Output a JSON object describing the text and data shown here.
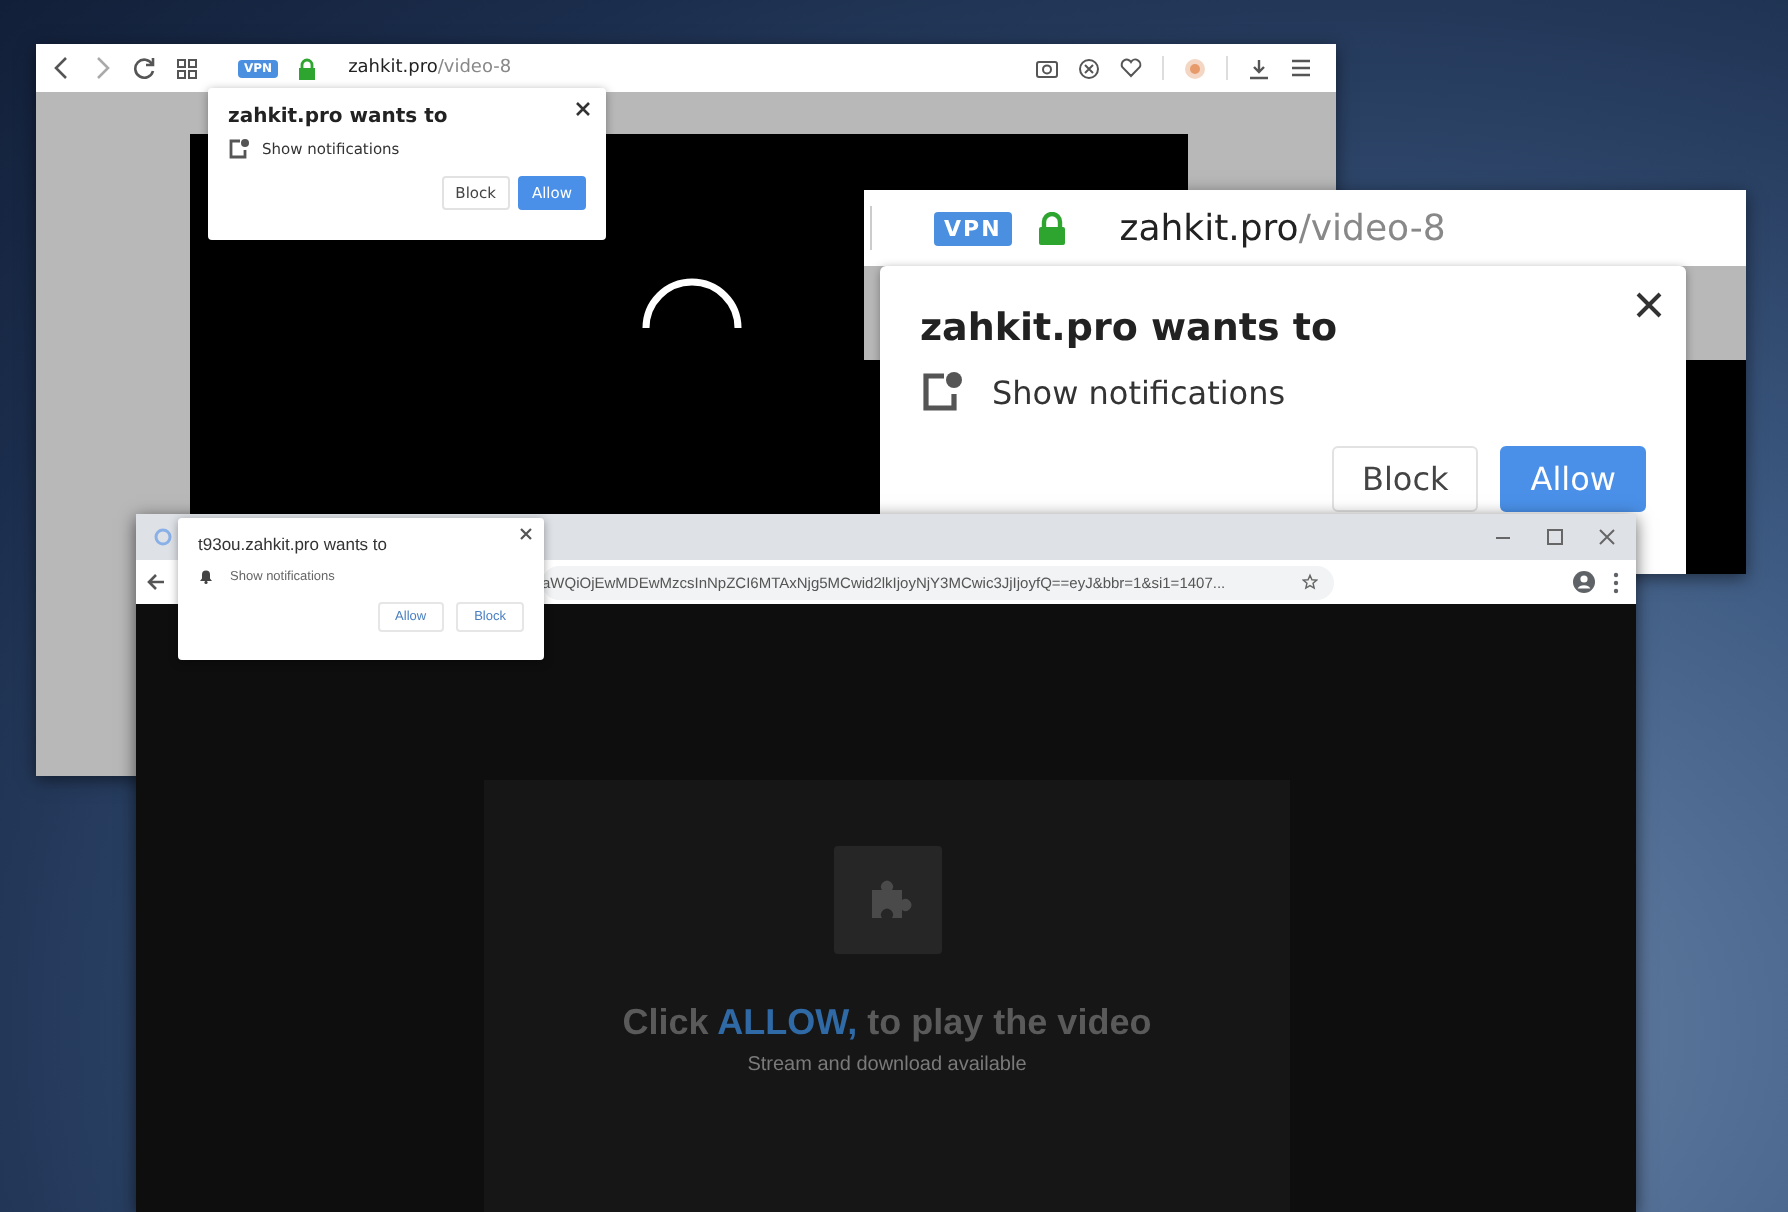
{
  "back_window": {
    "toolbar": {
      "vpn_badge": "VPN",
      "url_host": "zahkit.pro",
      "url_path": "/video-8"
    },
    "popup": {
      "title": "zahkit.pro wants to",
      "permission": "Show notifications",
      "buttons": [
        {
          "label": "Block",
          "kind": "secondary"
        },
        {
          "label": "Allow",
          "kind": "primary"
        }
      ]
    }
  },
  "zoomed_inset": {
    "toolbar": {
      "vpn_badge": "VPN",
      "url_host": "zahkit.pro",
      "url_path": "/video-8"
    },
    "popup": {
      "title": "zahkit.pro wants to",
      "permission": "Show notifications",
      "buttons": [
        {
          "label": "Block",
          "kind": "secondary"
        },
        {
          "label": "Allow",
          "kind": "primary"
        }
      ]
    }
  },
  "front_window": {
    "url": "aWQiOjEwMDEwMzcsInNpZCI6MTAxNjg5MCwid2lkIjoyNjY3MCwic3JjIjoyfQ==eyJ&bbr=1&si1=1407...",
    "popup": {
      "title": "t93ou.zahkit.pro wants to",
      "permission": "Show notifications",
      "buttons": [
        {
          "label": "Allow",
          "kind": "secondary"
        },
        {
          "label": "Block",
          "kind": "secondary"
        }
      ]
    },
    "video_message": [
      {
        "text": "Click",
        "highlighted": false
      },
      {
        "text": "ALLOW,",
        "highlighted": true
      },
      {
        "text": "to play the video",
        "highlighted": false
      }
    ],
    "video_subtitle": "Stream and download available"
  }
}
